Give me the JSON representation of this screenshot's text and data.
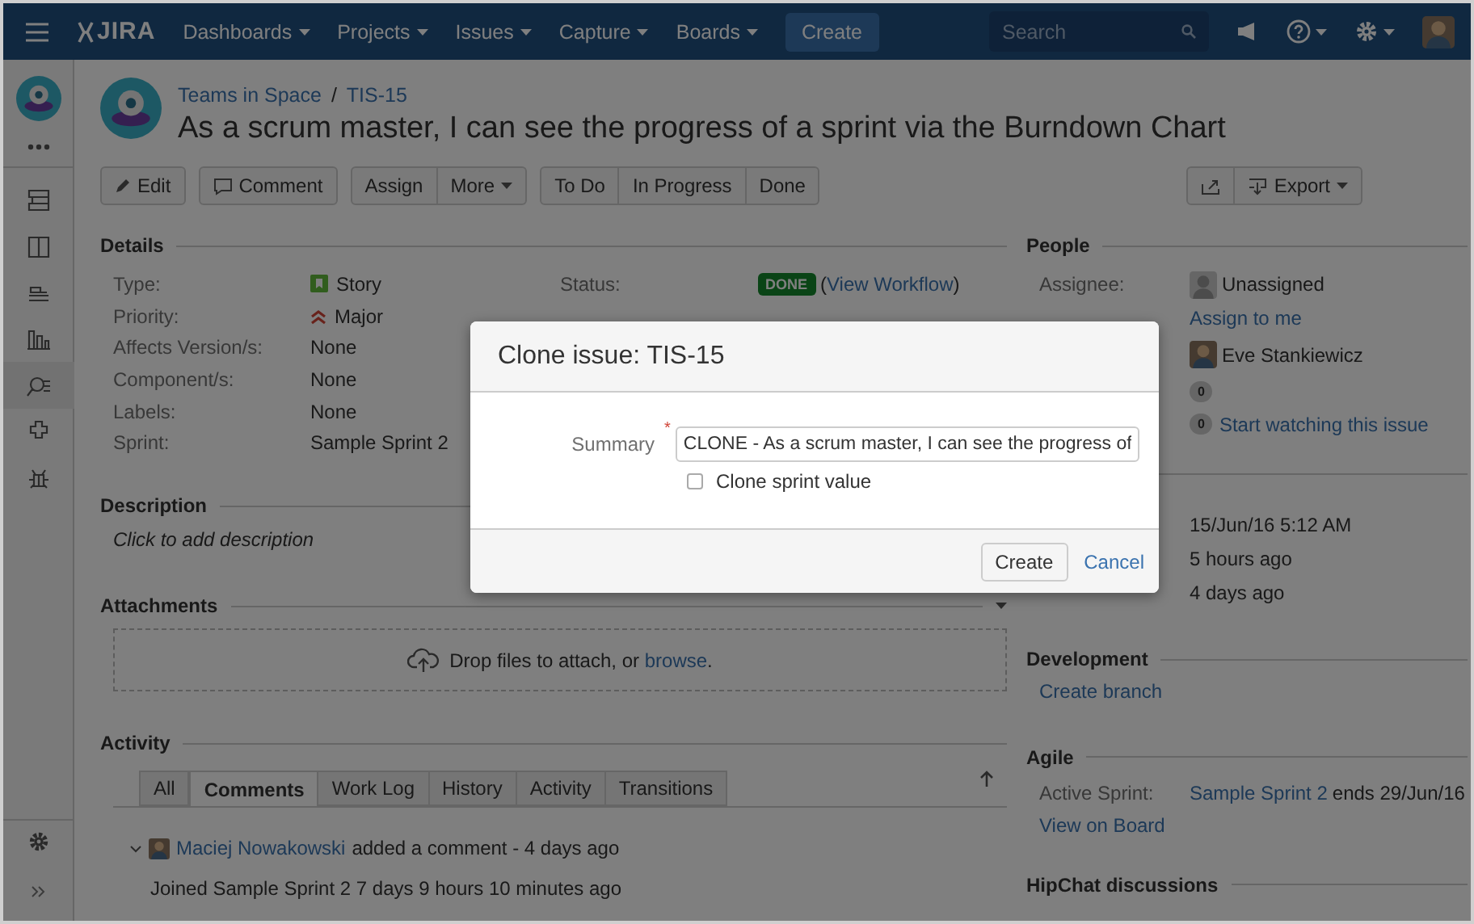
{
  "header": {
    "logo": "JIRA",
    "nav": [
      {
        "label": "Dashboards"
      },
      {
        "label": "Projects"
      },
      {
        "label": "Issues"
      },
      {
        "label": "Capture"
      },
      {
        "label": "Boards"
      }
    ],
    "create": "Create",
    "search": {
      "placeholder": "Search"
    }
  },
  "sidebar": {
    "items": [
      {
        "selected": false
      },
      {
        "selected": false
      },
      {
        "selected": false
      },
      {
        "selected": false
      },
      {
        "selected": true
      },
      {
        "selected": false
      },
      {
        "selected": false
      }
    ]
  },
  "issue": {
    "project": "Teams in Space",
    "separator": "/",
    "key": "TIS-15",
    "title": "As a scrum master, I can see the progress of a sprint via the Burndown Chart"
  },
  "toolbar": {
    "left": [
      [
        {
          "kind": "edit",
          "label": "Edit"
        }
      ],
      [
        {
          "kind": "comment",
          "label": "Comment"
        }
      ],
      [
        {
          "kind": "text",
          "label": "Assign"
        },
        {
          "kind": "menu",
          "label": "More"
        }
      ],
      [
        {
          "kind": "text",
          "label": "To Do"
        },
        {
          "kind": "text",
          "label": "In Progress"
        },
        {
          "kind": "text",
          "label": "Done"
        }
      ]
    ],
    "right": [
      [
        {
          "kind": "share"
        },
        {
          "kind": "export",
          "label": "Export"
        }
      ]
    ]
  },
  "details": {
    "heading": "Details",
    "left": [
      {
        "label": "Type:",
        "value": "Story",
        "kind": "type"
      },
      {
        "label": "Priority:",
        "value": "Major",
        "kind": "priority"
      },
      {
        "label": "Affects Version/s:",
        "value": "None",
        "kind": "plain"
      },
      {
        "label": "Component/s:",
        "value": "None",
        "kind": "plain"
      },
      {
        "label": "Labels:",
        "value": "None",
        "kind": "plain"
      },
      {
        "label": "Sprint:",
        "value": "Sample Sprint 2",
        "kind": "plain"
      }
    ],
    "right": [
      {
        "label": "Status:",
        "kind": "status",
        "badge": "DONE",
        "open": "(",
        "link": "View Workflow",
        "close": ")"
      }
    ]
  },
  "description": {
    "heading": "Description",
    "placeholder": "Click to add description"
  },
  "attachments": {
    "heading": "Attachments",
    "drop_text": "Drop files to attach, or",
    "link": "browse",
    "suffix": "."
  },
  "activity": {
    "heading": "Activity",
    "tabs": [
      {
        "label": "All",
        "selected": false
      },
      {
        "label": "Comments",
        "selected": true
      },
      {
        "label": "Work Log",
        "selected": false
      },
      {
        "label": "History",
        "selected": false
      },
      {
        "label": "Activity",
        "selected": false
      },
      {
        "label": "Transitions",
        "selected": false
      }
    ],
    "comments": [
      {
        "author": "Maciej Nowakowski",
        "action": "added a comment - 4 days ago",
        "body": "Joined Sample Sprint 2 7 days 9 hours 10 minutes ago"
      }
    ]
  },
  "people": {
    "heading": "People",
    "assignee_label": "Assignee:",
    "assignee": "Unassigned",
    "assign_link": "Assign to me",
    "reporter": "Eve Stankiewicz",
    "votes": "0",
    "watchers": "0",
    "watch_link": "Start watching this issue"
  },
  "dates": {
    "rows": [
      {
        "value": "15/Jun/16 5:12 AM"
      },
      {
        "value": "5 hours ago"
      },
      {
        "value": "4 days ago"
      }
    ]
  },
  "development": {
    "heading": "Development",
    "link": "Create branch"
  },
  "agile": {
    "heading": "Agile",
    "label": "Active Sprint:",
    "sprint": "Sample Sprint 2",
    "ends": "ends 29/Jun/16",
    "board_link": "View on Board"
  },
  "hipchat": {
    "heading": "HipChat discussions"
  },
  "dialog": {
    "title": "Clone issue: TIS-15",
    "summary_label": "Summary",
    "required": "*",
    "summary_value": "CLONE - As a scrum master, I can see the progress of",
    "clone_sprint": {
      "label": "Clone sprint value",
      "checked": false
    },
    "create": "Create",
    "cancel": "Cancel"
  }
}
